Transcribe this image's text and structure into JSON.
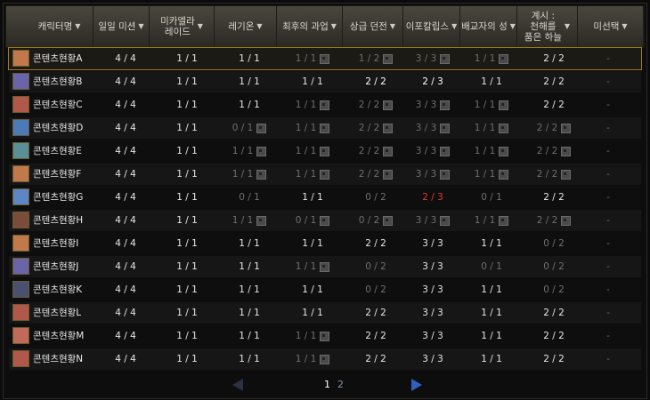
{
  "colors": {
    "header_bg": "#3b3832",
    "row_dark": "#0e0e0e",
    "row_light": "#161616",
    "selected_border": "#a07a1a",
    "dim_text": "#6f6f6f",
    "red_text": "#e23a2a",
    "next_arrow": "#2f5fbf"
  },
  "columns": [
    {
      "label": "캐릭터명",
      "has_arrow": true
    },
    {
      "label": "일일 미션",
      "has_arrow": true
    },
    {
      "label": "미카엘라\n레이드",
      "has_arrow": true
    },
    {
      "label": "레기온",
      "has_arrow": true
    },
    {
      "label": "최후의 과업",
      "has_arrow": true
    },
    {
      "label": "상급 던전",
      "has_arrow": true
    },
    {
      "label": "이포칼립스",
      "has_arrow": true
    },
    {
      "label": "배교자의 성",
      "has_arrow": true
    },
    {
      "label": "계시 :\n천해를\n품은 하늘",
      "has_arrow": true
    },
    {
      "label": "미선택",
      "has_arrow": true
    }
  ],
  "rows": [
    {
      "name": "콘텐츠현황A",
      "avatar": "#c0794a",
      "cells": [
        {
          "v": "4 / 4"
        },
        {
          "v": "1 / 1"
        },
        {
          "v": "1 / 1"
        },
        {
          "v": "1 / 1",
          "dim": true,
          "lock": true
        },
        {
          "v": "1 / 2",
          "dim": true,
          "lock": true
        },
        {
          "v": "3 / 3",
          "dim": true,
          "lock": true
        },
        {
          "v": "1 / 1",
          "dim": true,
          "lock": true
        },
        {
          "v": "2 / 2"
        },
        {
          "v": "-",
          "dim": true
        }
      ]
    },
    {
      "name": "콘텐츠현황B",
      "avatar": "#6a64a8",
      "cells": [
        {
          "v": "4 / 4"
        },
        {
          "v": "1 / 1"
        },
        {
          "v": "1 / 1"
        },
        {
          "v": "1 / 1"
        },
        {
          "v": "2 / 2",
          "bright": true
        },
        {
          "v": "2 / 3",
          "bright": true
        },
        {
          "v": "1 / 1"
        },
        {
          "v": "2 / 2"
        },
        {
          "v": "-",
          "dim": true
        }
      ]
    },
    {
      "name": "콘텐츠현황C",
      "avatar": "#b0584a",
      "cells": [
        {
          "v": "4 / 4"
        },
        {
          "v": "1 / 1"
        },
        {
          "v": "1 / 1"
        },
        {
          "v": "1 / 1",
          "dim": true,
          "lock": true
        },
        {
          "v": "2 / 2",
          "dim": true,
          "lock": true
        },
        {
          "v": "3 / 3",
          "dim": true,
          "lock": true
        },
        {
          "v": "1 / 1",
          "dim": true,
          "lock": true
        },
        {
          "v": "2 / 2"
        },
        {
          "v": "-",
          "dim": true
        }
      ]
    },
    {
      "name": "콘텐츠현황D",
      "avatar": "#4c7ab8",
      "cells": [
        {
          "v": "4 / 4"
        },
        {
          "v": "1 / 1"
        },
        {
          "v": "0 / 1",
          "dim": true,
          "lock": true
        },
        {
          "v": "1 / 1",
          "dim": true,
          "lock": true
        },
        {
          "v": "2 / 2",
          "dim": true,
          "lock": true
        },
        {
          "v": "3 / 3",
          "dim": true,
          "lock": true
        },
        {
          "v": "1 / 1",
          "dim": true,
          "lock": true
        },
        {
          "v": "2 / 2",
          "dim": true,
          "lock": true
        },
        {
          "v": "-",
          "dim": true
        }
      ]
    },
    {
      "name": "콘텐츠현황E",
      "avatar": "#5a8f96",
      "cells": [
        {
          "v": "4 / 4"
        },
        {
          "v": "1 / 1"
        },
        {
          "v": "1 / 1",
          "dim": true,
          "lock": true
        },
        {
          "v": "1 / 1",
          "dim": true,
          "lock": true
        },
        {
          "v": "2 / 2",
          "dim": true,
          "lock": true
        },
        {
          "v": "3 / 3",
          "dim": true,
          "lock": true
        },
        {
          "v": "1 / 1",
          "dim": true,
          "lock": true
        },
        {
          "v": "2 / 2",
          "dim": true,
          "lock": true
        },
        {
          "v": "-",
          "dim": true
        }
      ]
    },
    {
      "name": "콘텐츠현황F",
      "avatar": "#c0794a",
      "cells": [
        {
          "v": "4 / 4"
        },
        {
          "v": "1 / 1"
        },
        {
          "v": "1 / 1",
          "dim": true,
          "lock": true
        },
        {
          "v": "1 / 1",
          "dim": true,
          "lock": true
        },
        {
          "v": "2 / 2",
          "dim": true,
          "lock": true
        },
        {
          "v": "3 / 3",
          "dim": true,
          "lock": true
        },
        {
          "v": "1 / 1",
          "dim": true,
          "lock": true
        },
        {
          "v": "2 / 2",
          "dim": true,
          "lock": true
        },
        {
          "v": "-",
          "dim": true
        }
      ]
    },
    {
      "name": "콘텐츠현황G",
      "avatar": "#5f86c4",
      "cells": [
        {
          "v": "4 / 4"
        },
        {
          "v": "1 / 1"
        },
        {
          "v": "0 / 1",
          "dim": true
        },
        {
          "v": "1 / 1"
        },
        {
          "v": "0 / 2",
          "dim": true
        },
        {
          "v": "2 / 3",
          "red": true
        },
        {
          "v": "0 / 1",
          "dim": true
        },
        {
          "v": "2 / 2"
        },
        {
          "v": "-",
          "dim": true
        }
      ]
    },
    {
      "name": "콘텐츠현황H",
      "avatar": "#7a4c3a",
      "cells": [
        {
          "v": "4 / 4"
        },
        {
          "v": "1 / 1"
        },
        {
          "v": "1 / 1",
          "dim": true,
          "lock": true
        },
        {
          "v": "0 / 1",
          "dim": true,
          "lock": true
        },
        {
          "v": "0 / 2",
          "dim": true,
          "lock": true
        },
        {
          "v": "3 / 3",
          "dim": true,
          "lock": true
        },
        {
          "v": "1 / 1",
          "dim": true,
          "lock": true
        },
        {
          "v": "2 / 2",
          "dim": true,
          "lock": true
        },
        {
          "v": "-",
          "dim": true
        }
      ]
    },
    {
      "name": "콘텐츠현황I",
      "avatar": "#c0794a",
      "cells": [
        {
          "v": "4 / 4"
        },
        {
          "v": "1 / 1"
        },
        {
          "v": "1 / 1"
        },
        {
          "v": "1 / 1"
        },
        {
          "v": "2 / 2"
        },
        {
          "v": "3 / 3"
        },
        {
          "v": "1 / 1"
        },
        {
          "v": "0 / 2",
          "dim": true
        },
        {
          "v": "-",
          "dim": true
        }
      ]
    },
    {
      "name": "콘텐츠현황J",
      "avatar": "#6a64a8",
      "cells": [
        {
          "v": "4 / 4"
        },
        {
          "v": "1 / 1"
        },
        {
          "v": "1 / 1"
        },
        {
          "v": "1 / 1",
          "dim": true,
          "lock": true
        },
        {
          "v": "0 / 2",
          "dim": true
        },
        {
          "v": "3 / 3"
        },
        {
          "v": "0 / 1",
          "dim": true
        },
        {
          "v": "0 / 2",
          "dim": true
        },
        {
          "v": "-",
          "dim": true
        }
      ]
    },
    {
      "name": "콘텐츠현황K",
      "avatar": "#4a5070",
      "cells": [
        {
          "v": "4 / 4"
        },
        {
          "v": "1 / 1"
        },
        {
          "v": "1 / 1"
        },
        {
          "v": "1 / 1"
        },
        {
          "v": "0 / 2",
          "dim": true
        },
        {
          "v": "3 / 3"
        },
        {
          "v": "1 / 1"
        },
        {
          "v": "0 / 2",
          "dim": true
        },
        {
          "v": "-",
          "dim": true
        }
      ]
    },
    {
      "name": "콘텐츠현황L",
      "avatar": "#b0584a",
      "cells": [
        {
          "v": "4 / 4"
        },
        {
          "v": "1 / 1"
        },
        {
          "v": "1 / 1"
        },
        {
          "v": "1 / 1"
        },
        {
          "v": "2 / 2"
        },
        {
          "v": "3 / 3"
        },
        {
          "v": "1 / 1"
        },
        {
          "v": "2 / 2"
        },
        {
          "v": "-",
          "dim": true
        }
      ]
    },
    {
      "name": "콘텐츠현황M",
      "avatar": "#c06a5a",
      "cells": [
        {
          "v": "4 / 4"
        },
        {
          "v": "1 / 1"
        },
        {
          "v": "1 / 1"
        },
        {
          "v": "1 / 1",
          "dim": true,
          "lock": true
        },
        {
          "v": "2 / 2"
        },
        {
          "v": "3 / 3"
        },
        {
          "v": "1 / 1"
        },
        {
          "v": "2 / 2"
        },
        {
          "v": "-",
          "dim": true
        }
      ]
    },
    {
      "name": "콘텐츠현황N",
      "avatar": "#b0584a",
      "cells": [
        {
          "v": "4 / 4"
        },
        {
          "v": "1 / 1"
        },
        {
          "v": "1 / 1"
        },
        {
          "v": "1 / 1",
          "dim": true,
          "lock": true
        },
        {
          "v": "2 / 2"
        },
        {
          "v": "3 / 3"
        },
        {
          "v": "1 / 1"
        },
        {
          "v": "2 / 2"
        },
        {
          "v": "-",
          "dim": true
        }
      ]
    }
  ],
  "selected_row": 0,
  "pagination": {
    "pages": [
      "1",
      "2"
    ],
    "current": "1"
  }
}
